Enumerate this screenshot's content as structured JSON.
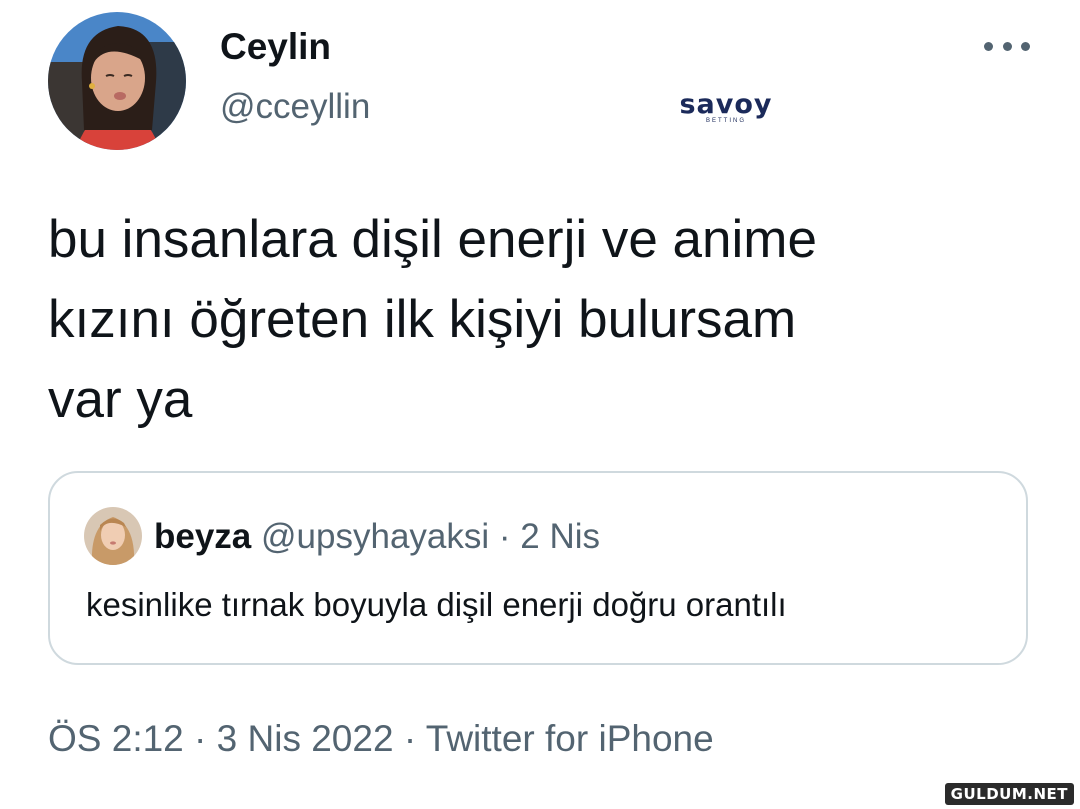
{
  "author": {
    "name": "Ceylin",
    "handle": "@cceyllin",
    "avatar_icon": "profile-photo"
  },
  "more_icon": "more-horizontal-icon",
  "brand_logo": {
    "word": "savoy",
    "sub": "BETTING"
  },
  "tweet": {
    "lines": [
      "bu insanlara dişil enerji ve anime",
      "kızını öğreten ilk kişiyi bulursam",
      "var ya"
    ]
  },
  "quote": {
    "name": "beyza",
    "handle": "@upsyhayaksi",
    "separator": "·",
    "date": "2 Nis",
    "text": "kesinlike tırnak boyuyla dişil enerji doğru orantılı"
  },
  "meta": {
    "time": "ÖS 2:12",
    "separator": "·",
    "date": "3 Nis 2022",
    "source": "Twitter for iPhone"
  },
  "watermark": "GULDUM.NET",
  "colors": {
    "text": "#0f1419",
    "secondary": "#536471",
    "border": "#cfd9de",
    "brand": "#1b2a5a"
  }
}
